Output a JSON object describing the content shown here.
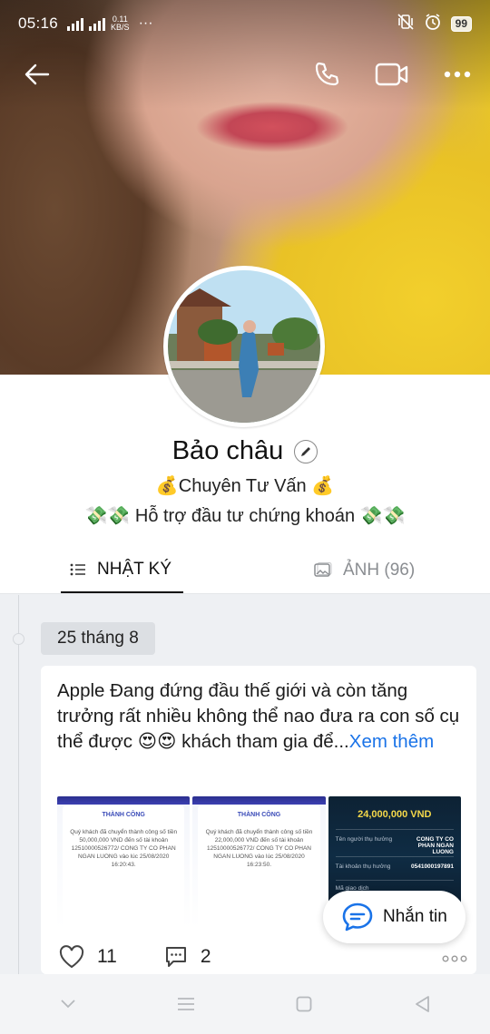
{
  "status_bar": {
    "time": "05:16",
    "network_speed_value": "0.11",
    "network_speed_unit": "KB/S",
    "battery": "99"
  },
  "profile": {
    "name": "Bảo châu",
    "bio_line1": "💰Chuyên Tư Vấn 💰",
    "bio_line2": "💸💸 Hỗ trợ đầu tư chứng khoán 💸💸"
  },
  "tabs": [
    {
      "label": "NHẬT KÝ",
      "active": true
    },
    {
      "label": "ẢNH (96)",
      "active": false
    }
  ],
  "feed": {
    "date": "25 tháng 8",
    "post": {
      "text": "Apple Đang đứng đầu thế giới và còn tăng trưởng rất nhiều không thể nao đưa ra con số cụ thể được 😍😍 khách tham gia để...",
      "see_more": "Xem thêm",
      "images": [
        {
          "title": "THÀNH CÔNG",
          "line1": "Quý khách đã chuyển thành công số tiền 50,000,000 VND đến số tài khoản 12510000526772/ CONG TY CO PHAN NGAN LUONG vào lúc 25/08/2020 16:20:43."
        },
        {
          "title": "THÀNH CÔNG",
          "line1": "Quý khách đã chuyển thành công số tiền 22,000,000 VND đến số tài khoản 12510000526772/ CONG TY CO PHAN NGAN LUONG vào lúc 25/08/2020 16:23:50."
        },
        {
          "amount": "24,000,000 VND",
          "row1_label": "Tên người thụ hưởng",
          "row1_value": "CONG TY CO PHAN NGAN LUONG",
          "row2_label": "Tài khoản thụ hưởng",
          "row2_value": "0541000197891",
          "row3_label": "Mã giao dịch",
          "row3_value": "745771531"
        }
      ],
      "likes": "11",
      "comments": "2"
    }
  },
  "fab": {
    "label": "Nhắn tin"
  },
  "colors": {
    "accent_link": "#1a73e8",
    "fab_icon": "#1a73e8"
  }
}
